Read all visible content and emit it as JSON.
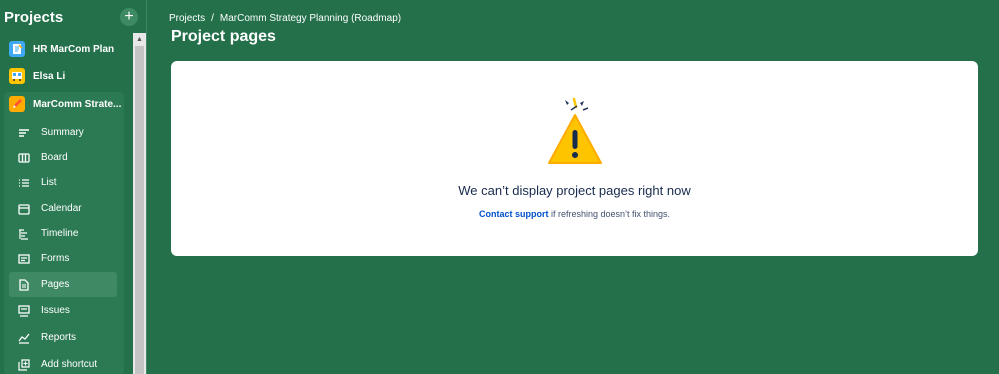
{
  "sidebar": {
    "title": "Projects",
    "add_label": "+",
    "projects": [
      {
        "name": "HR MarCom Plan",
        "icon": "notepad-icon",
        "color": "#3fa9f5"
      },
      {
        "name": "Elsa Li",
        "icon": "bus-icon",
        "color": "#ffc400"
      },
      {
        "name": "MarComm Strate...",
        "icon": "pencil-icon",
        "color": "#ffab00"
      }
    ],
    "nav": [
      {
        "label": "Summary",
        "icon": "summary-icon"
      },
      {
        "label": "Board",
        "icon": "board-icon"
      },
      {
        "label": "List",
        "icon": "list-icon"
      },
      {
        "label": "Calendar",
        "icon": "calendar-icon"
      },
      {
        "label": "Timeline",
        "icon": "timeline-icon"
      },
      {
        "label": "Forms",
        "icon": "forms-icon"
      },
      {
        "label": "Pages",
        "icon": "pages-icon",
        "active": true
      },
      {
        "label": "Issues",
        "icon": "issues-icon"
      },
      {
        "label": "Reports",
        "icon": "reports-icon"
      },
      {
        "label": "Add shortcut",
        "icon": "add-shortcut-icon"
      }
    ]
  },
  "breadcrumb": {
    "root": "Projects",
    "separator": "/",
    "current": "MarComm Strategy Planning (Roadmap)"
  },
  "page_title": "Project pages",
  "error": {
    "title": "We can’t display project pages right now",
    "link": "Contact support",
    "rest": " if refreshing doesn’t fix things."
  },
  "colors": {
    "background": "#23704b",
    "card": "#ffffff",
    "warning": "#ffc400",
    "link": "#0052cc"
  }
}
